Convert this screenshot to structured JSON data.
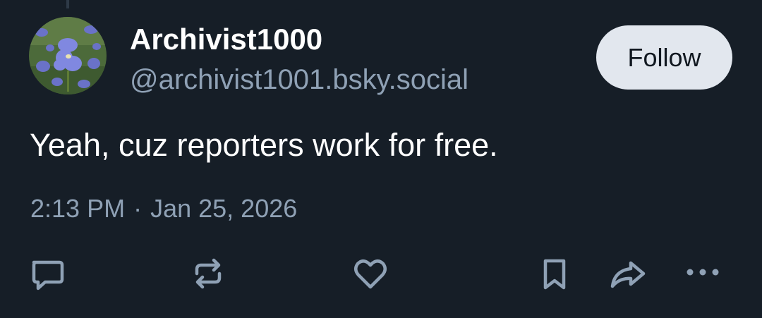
{
  "author": {
    "display_name": "Archivist1000",
    "handle": "@archivist1001.bsky.social",
    "avatar_icon": "iris-flowers-avatar"
  },
  "follow_button": {
    "label": "Follow"
  },
  "post": {
    "text": "Yeah, cuz reporters work for free.",
    "time": "2:13 PM",
    "separator": "·",
    "date": "Jan 25, 2026"
  },
  "actions": [
    {
      "name": "reply",
      "icon": "speech-bubble-icon"
    },
    {
      "name": "repost",
      "icon": "repost-arrows-icon"
    },
    {
      "name": "like",
      "icon": "heart-icon"
    },
    {
      "name": "bookmark",
      "icon": "bookmark-icon"
    },
    {
      "name": "share",
      "icon": "share-arrow-icon"
    },
    {
      "name": "more",
      "icon": "more-dots-icon"
    }
  ],
  "colors": {
    "background": "#161e27",
    "text_primary": "#ffffff",
    "text_secondary": "#8fa1b5",
    "icon": "#8fa1b5",
    "button_bg": "#e2e7ee",
    "button_text": "#111820"
  }
}
